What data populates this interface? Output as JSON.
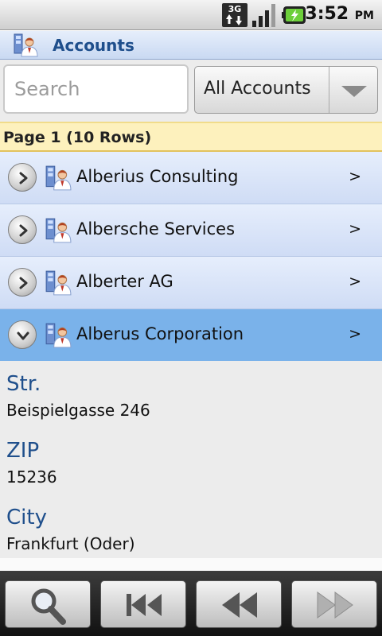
{
  "status_bar": {
    "network_label": "3G",
    "time": "3:52",
    "ampm": "PM",
    "icons": [
      "network-3g-icon",
      "signal-strength-icon",
      "battery-icon"
    ]
  },
  "title_bar": {
    "title": "Accounts",
    "icon": "accounts-icon"
  },
  "search": {
    "placeholder": "Search",
    "value": ""
  },
  "filter": {
    "selected": "All Accounts"
  },
  "page_header": "Page 1 (10 Rows)",
  "rows": [
    {
      "label": "Alberius Consulting",
      "chevron": ">",
      "expanded": false
    },
    {
      "label": "Albersche Services",
      "chevron": ">",
      "expanded": false
    },
    {
      "label": "Alberter AG",
      "chevron": ">",
      "expanded": false
    },
    {
      "label": "Alberus Corporation",
      "chevron": ">",
      "expanded": true
    }
  ],
  "details": [
    {
      "label": "Str.",
      "value": "Beispielgasse 246"
    },
    {
      "label": "ZIP",
      "value": "15236"
    },
    {
      "label": "City",
      "value": "Frankfurt (Oder)"
    }
  ],
  "toolbar": {
    "buttons": [
      "search-icon",
      "first-page-icon",
      "previous-page-icon",
      "next-page-icon"
    ]
  },
  "colors": {
    "title_text": "#1f4f8c",
    "row_background": "#d9e4f8",
    "row_selected": "#7ab2ea",
    "page_header_background": "#fdf1bd"
  }
}
